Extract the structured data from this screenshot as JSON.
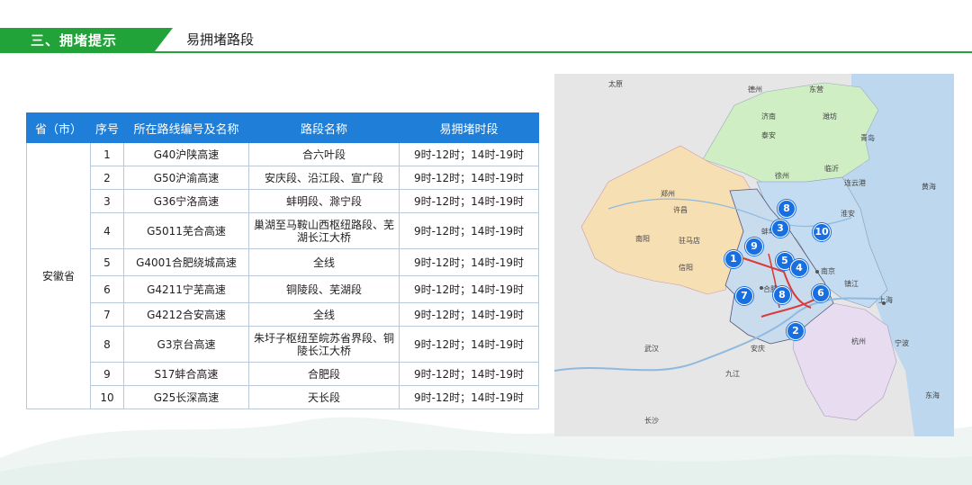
{
  "header": {
    "section_label": "三、拥堵提示",
    "title": "易拥堵路段",
    "accent": "#22a33a"
  },
  "table": {
    "columns": [
      "省（市）",
      "序号",
      "所在路线编号及名称",
      "路段名称",
      "易拥堵时段"
    ],
    "province": "安徽省",
    "rows": [
      {
        "no": "1",
        "route": "G40沪陕高速",
        "section": "合六叶段",
        "time": "9时-12时；14时-19时"
      },
      {
        "no": "2",
        "route": "G50沪渝高速",
        "section": "安庆段、沿江段、宣广段",
        "time": "9时-12时；14时-19时"
      },
      {
        "no": "3",
        "route": "G36宁洛高速",
        "section": "蚌明段、滁宁段",
        "time": "9时-12时；14时-19时"
      },
      {
        "no": "4",
        "route": "G5011芜合高速",
        "section": "巢湖至马鞍山西枢纽路段、芜湖长江大桥",
        "time": "9时-12时；14时-19时"
      },
      {
        "no": "5",
        "route": "G4001合肥绕城高速",
        "section": "全线",
        "time": "9时-12时；14时-19时"
      },
      {
        "no": "6",
        "route": "G4211宁芜高速",
        "section": "铜陵段、芜湖段",
        "time": "9时-12时；14时-19时"
      },
      {
        "no": "7",
        "route": "G4212合安高速",
        "section": "全线",
        "time": "9时-12时；14时-19时"
      },
      {
        "no": "8",
        "route": "G3京台高速",
        "section": "朱圩子枢纽至皖苏省界段、铜陵长江大桥",
        "time": "9时-12时；14时-19时"
      },
      {
        "no": "9",
        "route": "S17蚌合高速",
        "section": "合肥段",
        "time": "9时-12时；14时-19时"
      },
      {
        "no": "10",
        "route": "G25长深高速",
        "section": "天长段",
        "time": "9时-12时；14时-19时"
      }
    ]
  },
  "map": {
    "markers": [
      "8",
      "3",
      "10",
      "9",
      "1",
      "5",
      "4",
      "7",
      "8",
      "6",
      "2"
    ],
    "labels": [
      "太原",
      "德州",
      "东营",
      "济南",
      "潍坊",
      "青岛",
      "泰安",
      "临沂",
      "郑州",
      "许昌",
      "南阳",
      "驻马店",
      "信阳",
      "徐州",
      "连云港",
      "淮安",
      "蚌埠",
      "合肥",
      "南京",
      "镇江",
      "上海",
      "杭州",
      "宁波",
      "武汉",
      "长沙",
      "九江",
      "安庆",
      "黄海",
      "东海"
    ],
    "colors": {
      "anhui": "#c9dcee",
      "henan": "#f7dfb4",
      "shandong": "#cfeec4",
      "jiangsu": "#c4dcf2",
      "zhejiang": "#e8dcf0",
      "sea": "#bcd7ee",
      "land": "#e4e4e4"
    }
  }
}
